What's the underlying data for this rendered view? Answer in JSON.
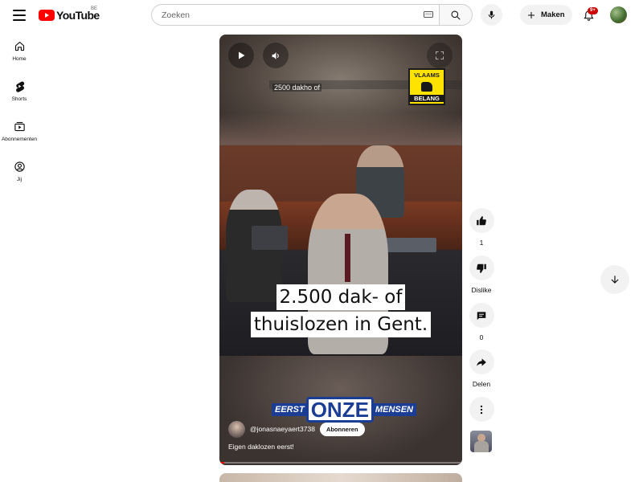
{
  "header": {
    "logo_text": "YouTube",
    "region": "BE",
    "search_placeholder": "Zoeken",
    "create_label": "Maken",
    "notification_count": "9+"
  },
  "sidebar": {
    "items": [
      {
        "label": "Home",
        "icon": "home-icon"
      },
      {
        "label": "Shorts",
        "icon": "shorts-icon"
      },
      {
        "label": "Abonnementen",
        "icon": "subscriptions-icon"
      },
      {
        "label": "Jij",
        "icon": "you-icon"
      }
    ]
  },
  "video": {
    "title_overlay": "2500 dakho of",
    "logo_top": "VLAAMS",
    "logo_bottom": "BELANG",
    "subtitle_line1": "2.500 dak- of",
    "subtitle_line2": "thuislozen in Gent.",
    "banner_left": "EERST",
    "banner_mid": "ONZE",
    "banner_right": "MENSEN",
    "channel": "@jonasnaeyaert3738",
    "subscribe_label": "Abonneren",
    "caption": "Eigen daklozen eerst!",
    "progress": 0.02
  },
  "actions": {
    "likes": "1",
    "dislike_label": "Dislike",
    "comments": "0",
    "share_label": "Delen"
  },
  "colors": {
    "brand_red": "#ff0000",
    "banner_blue": "#1b3e94",
    "party_yellow": "#ffe300"
  }
}
